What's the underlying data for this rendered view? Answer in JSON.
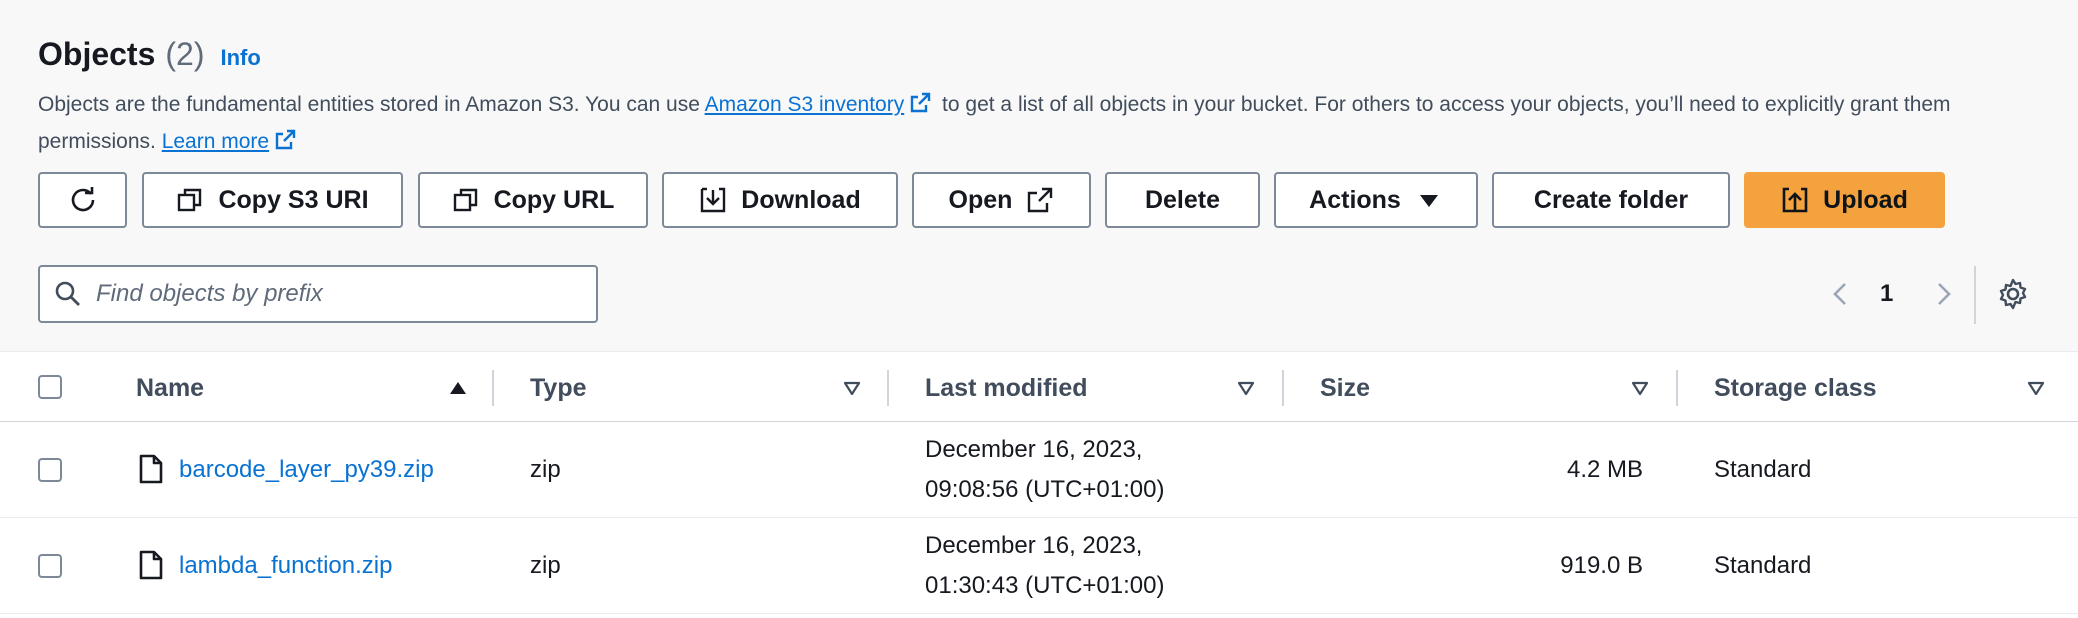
{
  "header": {
    "title": "Objects",
    "count": "(2)",
    "info_label": "Info",
    "desc_part1": "Objects are the fundamental entities stored in Amazon S3. You can use ",
    "inventory_link": "Amazon S3 inventory",
    "desc_part2": " to get a list of all objects in your bucket. For others to access your objects, you’ll need to explicitly grant them permissions. ",
    "learn_more": "Learn more"
  },
  "toolbar": {
    "refresh_icon": "refresh-icon",
    "copy_s3_uri": "Copy S3 URI",
    "copy_url": "Copy URL",
    "download": "Download",
    "open": "Open",
    "delete": "Delete",
    "actions": "Actions",
    "create_folder": "Create folder",
    "upload": "Upload"
  },
  "search": {
    "placeholder": "Find objects by prefix"
  },
  "pagination": {
    "current_page": "1"
  },
  "table": {
    "columns": [
      "Name",
      "Type",
      "Last modified",
      "Size",
      "Storage class"
    ],
    "rows": [
      {
        "name": "barcode_layer_py39.zip",
        "type": "zip",
        "modified_line1": "December 16, 2023,",
        "modified_line2": "09:08:56 (UTC+01:00)",
        "size": "4.2 MB",
        "storage_class": "Standard"
      },
      {
        "name": "lambda_function.zip",
        "type": "zip",
        "modified_line1": "December 16, 2023,",
        "modified_line2": "01:30:43 (UTC+01:00)",
        "size": "919.0 B",
        "storage_class": "Standard"
      }
    ]
  },
  "colors": {
    "accent": "#0972d3",
    "primary_button": "#f4a23e",
    "border": "#7d8998"
  }
}
